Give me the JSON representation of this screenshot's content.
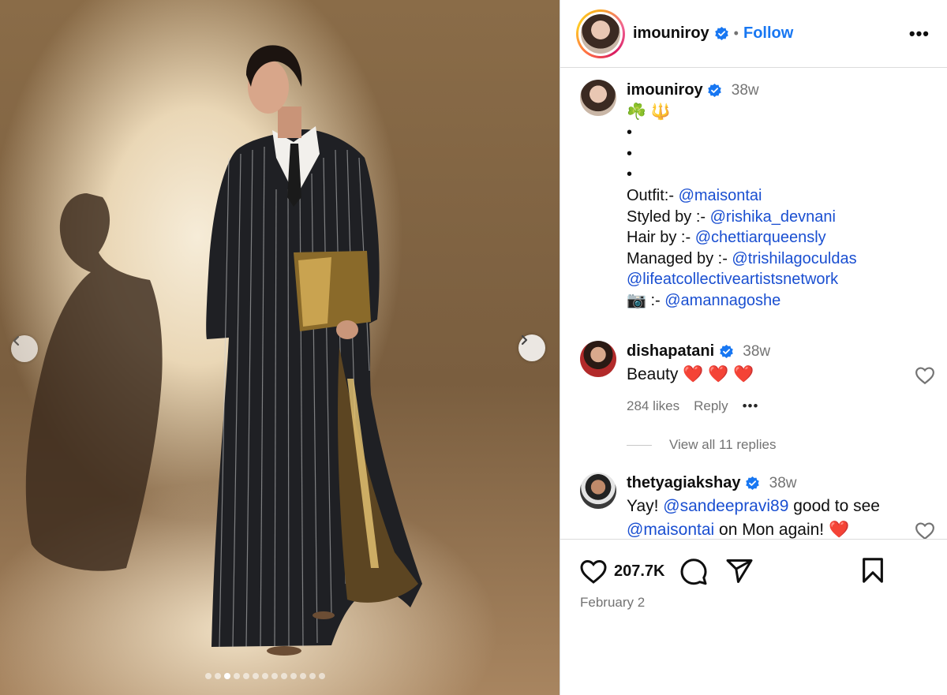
{
  "post": {
    "username": "imouniroy",
    "follow_label": "Follow",
    "separator": "•",
    "more_label": "•••",
    "carousel": {
      "total": 13,
      "active_index": 2
    }
  },
  "caption": {
    "username": "imouniroy",
    "time": "38w",
    "emoji_line": "☘️ 🔱",
    "bullets": [
      "•",
      "•",
      "•"
    ],
    "outfit_label": "Outfit:- ",
    "outfit_mention": "@maisontai",
    "styled_label": "Styled by :- ",
    "styled_mention": "@rishika_devnani",
    "hair_label": "Hair by :- ",
    "hair_mention": "@chettiarqueensly",
    "managed_label": "Managed by :- ",
    "managed_mention": "@trishilagoculdas",
    "agency_mention": "@lifeatcollectiveartistsnetwork",
    "camera_label": "📷 :- ",
    "camera_mention": "@amannagoshe"
  },
  "comments": [
    {
      "username": "dishapatani",
      "time": "38w",
      "text": "Beauty ❤️ ❤️ ❤️",
      "likes": "284 likes",
      "reply_label": "Reply",
      "more_label": "•••",
      "view_replies": "View all 11 replies"
    },
    {
      "username": "thetyagiakshay",
      "time": "38w",
      "text_prefix": "Yay! ",
      "mention1": "@sandeepravi89",
      "text_mid": " good to see",
      "mention2": "@maisontai",
      "text_suffix": " on Mon again!  ❤️"
    }
  ],
  "actions": {
    "like_count": "207.7K",
    "date": "February 2",
    "icons": [
      "heart-icon",
      "comment-icon",
      "share-icon",
      "bookmark-icon"
    ]
  },
  "colors": {
    "link": "#1a4fd1",
    "follow": "#1877f2",
    "verified": "#1877f2",
    "muted": "#737373"
  }
}
